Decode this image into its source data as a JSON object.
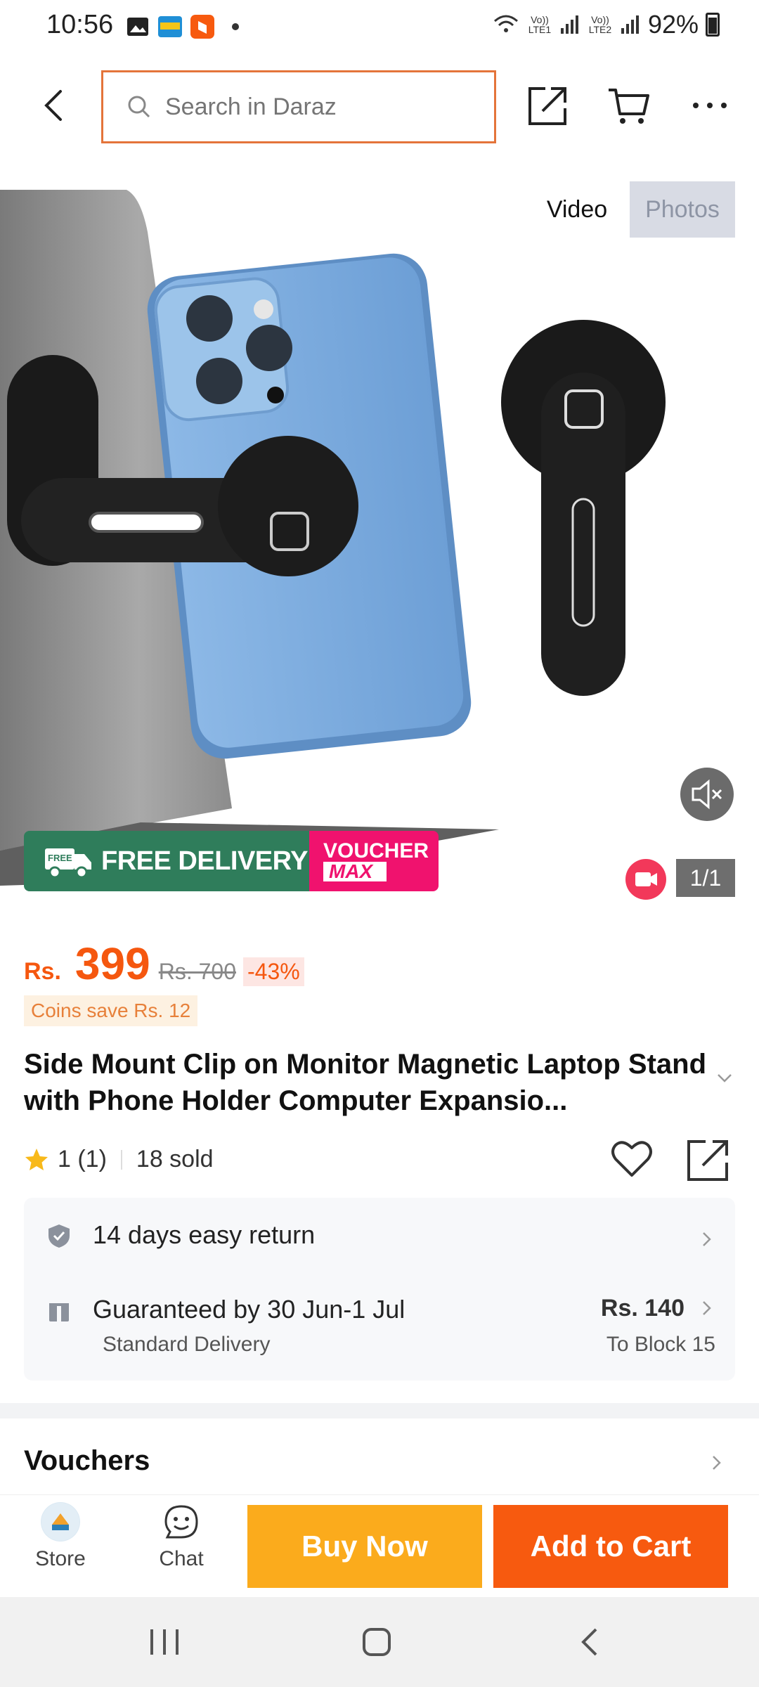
{
  "status_bar": {
    "time": "10:56",
    "sim1": "Vo)) LTE1",
    "sim2": "Vo)) LTE2",
    "battery": "92%"
  },
  "header": {
    "search_placeholder": "Search in Daraz"
  },
  "media": {
    "tab_video": "Video",
    "tab_photos": "Photos",
    "counter": "1/1",
    "banner_free": "FREE",
    "banner_delivery": "FREE DELIVERY",
    "banner_voucher": "VOUCHER",
    "banner_max": "MAX"
  },
  "product": {
    "currency": "Rs.",
    "price": "399",
    "old_price": "Rs. 700",
    "discount": "-43%",
    "coins": "Coins save Rs. 12",
    "title": "Side Mount Clip on Monitor Magnetic Laptop Stand with Phone Holder Computer Expansio...",
    "rating": "1 (1)",
    "sold": "18 sold"
  },
  "service": {
    "return": "14 days easy return",
    "delivery": "Guaranteed by 30 Jun-1 Jul",
    "delivery_type": "Standard Delivery",
    "fee": "Rs. 140",
    "destination": "To Block 15"
  },
  "vouchers": {
    "title": "Vouchers"
  },
  "bottom_bar": {
    "store": "Store",
    "chat": "Chat",
    "buy_now": "Buy Now",
    "add_to_cart": "Add to Cart"
  },
  "colors": {
    "accent": "#f75a0f",
    "buy_now": "#fbab1c",
    "delivery_green": "#2f7d5b",
    "voucher_pink": "#f0126e"
  }
}
